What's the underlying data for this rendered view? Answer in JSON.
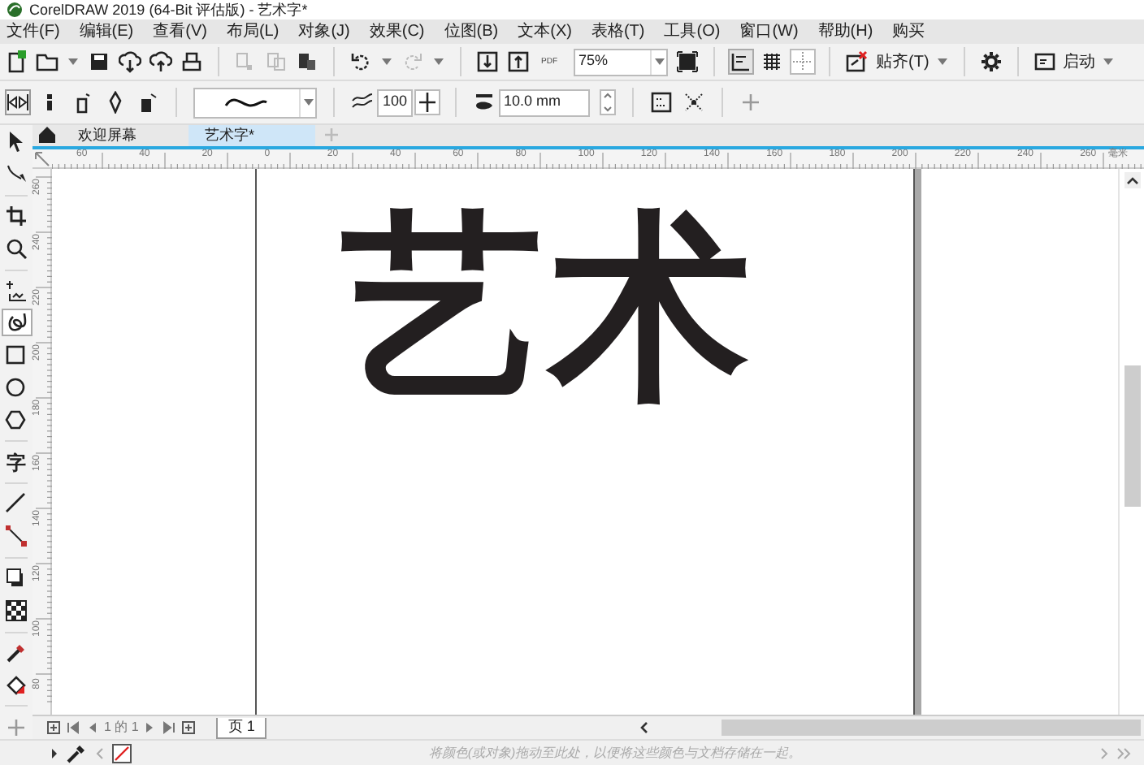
{
  "window": {
    "title": "CorelDRAW 2019 (64-Bit 评估版) - 艺术字*"
  },
  "menu": [
    "文件(F)",
    "编辑(E)",
    "查看(V)",
    "布局(L)",
    "对象(J)",
    "效果(C)",
    "位图(B)",
    "文本(X)",
    "表格(T)",
    "工具(O)",
    "窗口(W)",
    "帮助(H)",
    "购买"
  ],
  "toolbar": {
    "pdf_label": "PDF",
    "zoom": "75%",
    "snap": "贴齐(T)",
    "launch": "启动"
  },
  "property_bar": {
    "smoothing": "100",
    "width": "10.0 mm"
  },
  "document_tabs": [
    {
      "label": "欢迎屏幕",
      "selected": false
    },
    {
      "label": "艺术字*",
      "selected": true
    }
  ],
  "toolbox": [
    {
      "kind": "pick",
      "selected": false
    },
    {
      "kind": "shape",
      "selected": false
    },
    {
      "kind": "crop",
      "selected": false
    },
    {
      "kind": "zoom",
      "selected": false
    },
    {
      "kind": "freehand",
      "selected": false
    },
    {
      "kind": "artistic",
      "selected": true
    },
    {
      "kind": "rectangle",
      "selected": false
    },
    {
      "kind": "ellipse",
      "selected": false
    },
    {
      "kind": "polygon",
      "selected": false
    },
    {
      "kind": "text",
      "selected": false,
      "glyph": "字"
    },
    {
      "kind": "line",
      "selected": false
    },
    {
      "kind": "connector",
      "selected": false
    },
    {
      "kind": "shadow",
      "selected": false
    },
    {
      "kind": "transparency",
      "selected": false
    },
    {
      "kind": "eyedropper",
      "selected": false
    },
    {
      "kind": "fill",
      "selected": false
    },
    {
      "kind": "add",
      "selected": false
    }
  ],
  "ruler": {
    "horizontal": [
      "60",
      "40",
      "20",
      "0",
      "20",
      "40",
      "60",
      "80",
      "100",
      "120",
      "140",
      "160",
      "180",
      "200",
      "220",
      "240",
      "260"
    ],
    "unit": "毫米",
    "vertical": [
      "260",
      "240",
      "220",
      "200",
      "180",
      "160",
      "140",
      "120",
      "100",
      "80"
    ]
  },
  "canvas": {
    "text": "艺术"
  },
  "page_nav": {
    "counter": "1 的 1",
    "page_tab": "页 1"
  },
  "palette": {
    "hint": "将颜色(或对象)拖动至此处，以便将这些颜色与文档存储在一起。"
  }
}
